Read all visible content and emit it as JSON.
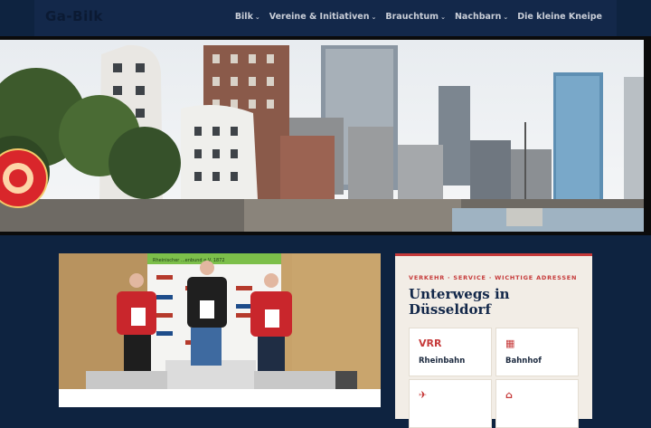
{
  "brand": {
    "logo_text": "Ga-Bilk"
  },
  "nav": {
    "items": [
      {
        "label": "Bilk",
        "has_dropdown": true
      },
      {
        "label": "Vereine & Initiativen",
        "has_dropdown": true
      },
      {
        "label": "Brauchtum",
        "has_dropdown": true
      },
      {
        "label": "Nachbarn",
        "has_dropdown": true
      },
      {
        "label": "Die kleine Kneipe",
        "has_dropdown": false
      }
    ]
  },
  "photo": {
    "banner_text": "Rheinischer ...enbund e.V. 1872"
  },
  "sidebar": {
    "kicker": "VERKEHR · SERVICE · WICHTIGE ADRESSEN",
    "title": "Unterwegs in Düsseldorf",
    "tiles": [
      {
        "icon": "VRR",
        "label": "Rheinbahn",
        "icon_name": "vrr-logo"
      },
      {
        "icon": "▦",
        "label": "Bahnhof",
        "icon_name": "train-station-icon"
      },
      {
        "icon": "✈",
        "label": "",
        "icon_name": "airplane-icon"
      },
      {
        "icon": "⌂",
        "label": "",
        "icon_name": "home-icon"
      }
    ]
  },
  "colors": {
    "nav_bg": "#13284a",
    "page_bg": "#0e2340",
    "accent": "#c63a3a",
    "card_bg": "#f2ede6"
  }
}
